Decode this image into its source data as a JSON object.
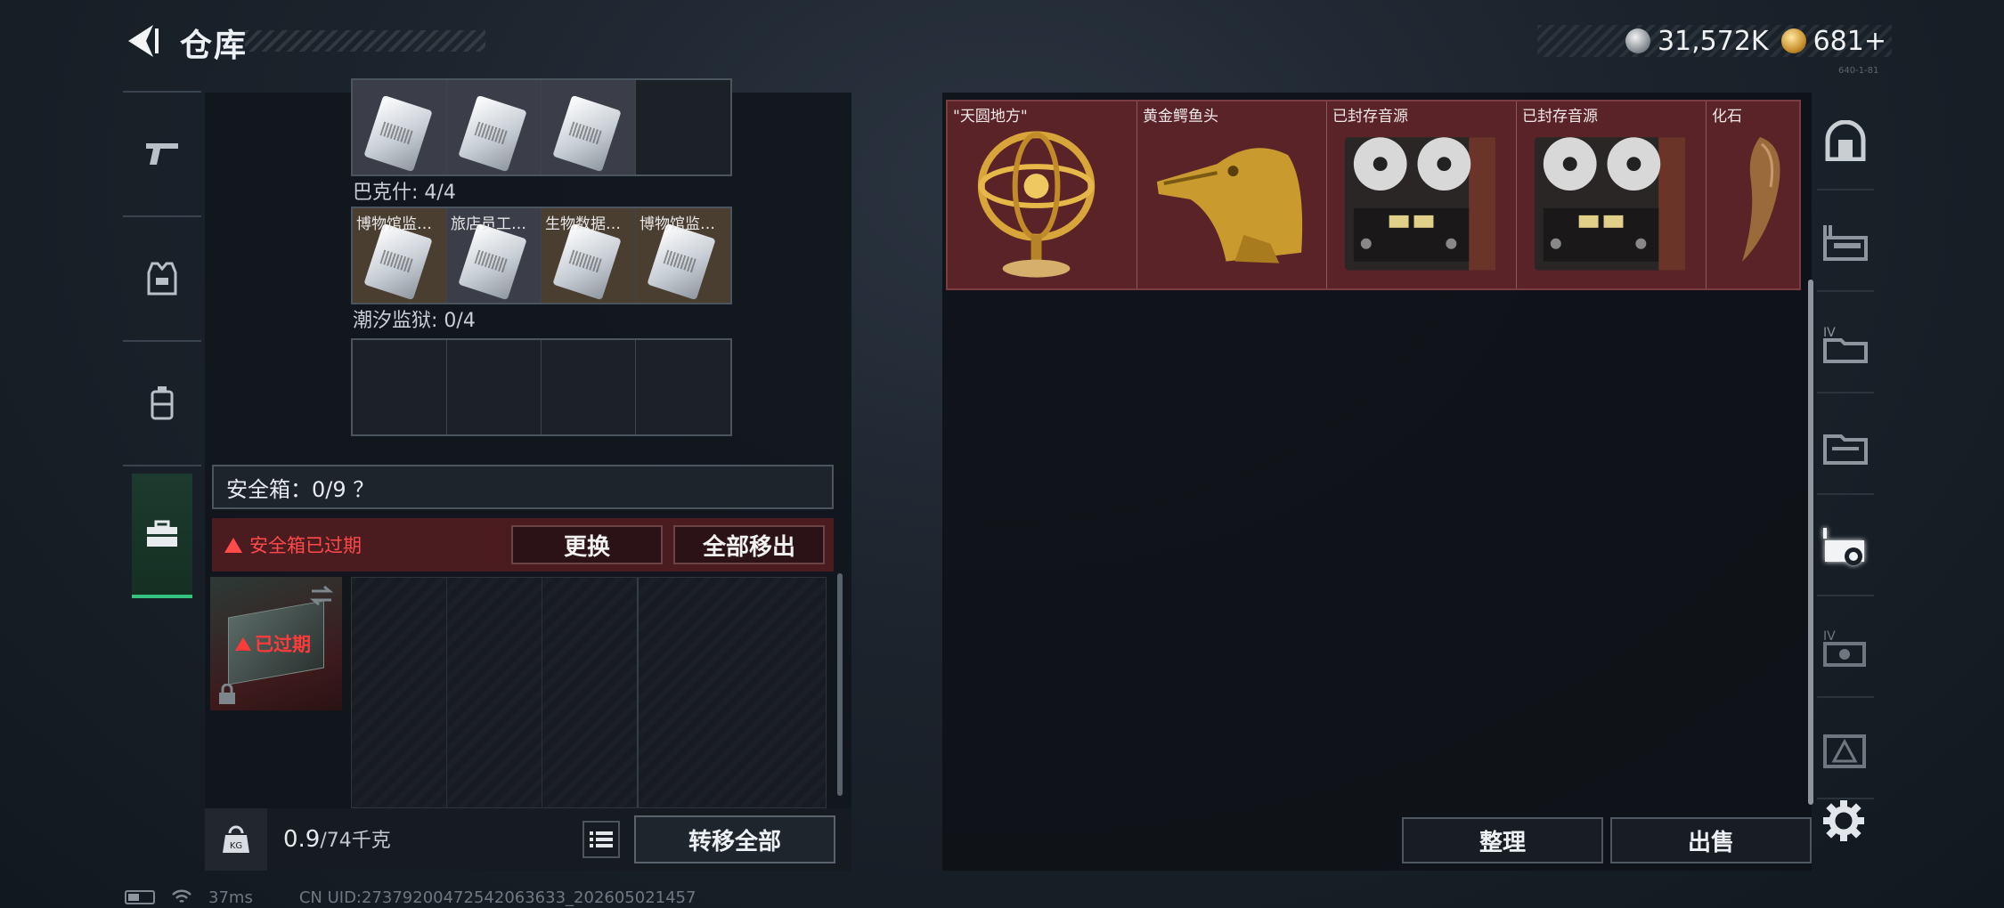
{
  "header": {
    "title": "仓库"
  },
  "currency": [
    {
      "name": "silver-coin",
      "value": "31,572K"
    },
    {
      "name": "gold-coin",
      "value": "681+"
    }
  ],
  "version": "640-1-81",
  "left_tabs": [
    {
      "icon": "gun-icon",
      "active": false
    },
    {
      "icon": "vest-icon",
      "active": false
    },
    {
      "icon": "backpack-icon",
      "active": false
    },
    {
      "icon": "briefcase-icon",
      "active": true
    }
  ],
  "collections": {
    "top_row_slots": [
      "",
      "",
      "",
      ""
    ],
    "bakesh_label": "巴克什: 4/4",
    "bakesh_slots": [
      "博物馆监…",
      "旅店员工…",
      "生物数据…",
      "博物馆监…"
    ],
    "chaoxi_label": "潮汐监狱: 0/4"
  },
  "safe_box": {
    "header": "安全箱：0/9 ？",
    "warning": "安全箱已过期",
    "replace_btn": "更换",
    "remove_all_btn": "全部移出",
    "expired_badge": "已过期"
  },
  "bottom": {
    "weight_value": "0.9",
    "weight_max": "/74千克",
    "transfer_btn": "转移全部"
  },
  "right_items": [
    {
      "label": "\"天圆地方\"",
      "kind": "armillary"
    },
    {
      "label": "黄金鳄鱼头",
      "kind": "croc"
    },
    {
      "label": "已封存音源",
      "kind": "tape"
    },
    {
      "label": "已封存音源",
      "kind": "tape"
    },
    {
      "label": "化石",
      "kind": "fossil"
    }
  ],
  "right_tabs": [
    "vault-icon",
    "weapon-case-icon",
    "folder-4-icon",
    "folder-icon",
    "gear-box-active-icon",
    "case-4-icon",
    "triangle-box-icon"
  ],
  "actions": {
    "sort_btn": "整理",
    "sell_btn": "出售"
  },
  "status": {
    "ping": "37ms",
    "uid": "CN UID:27379200472542063633_202605021457"
  }
}
